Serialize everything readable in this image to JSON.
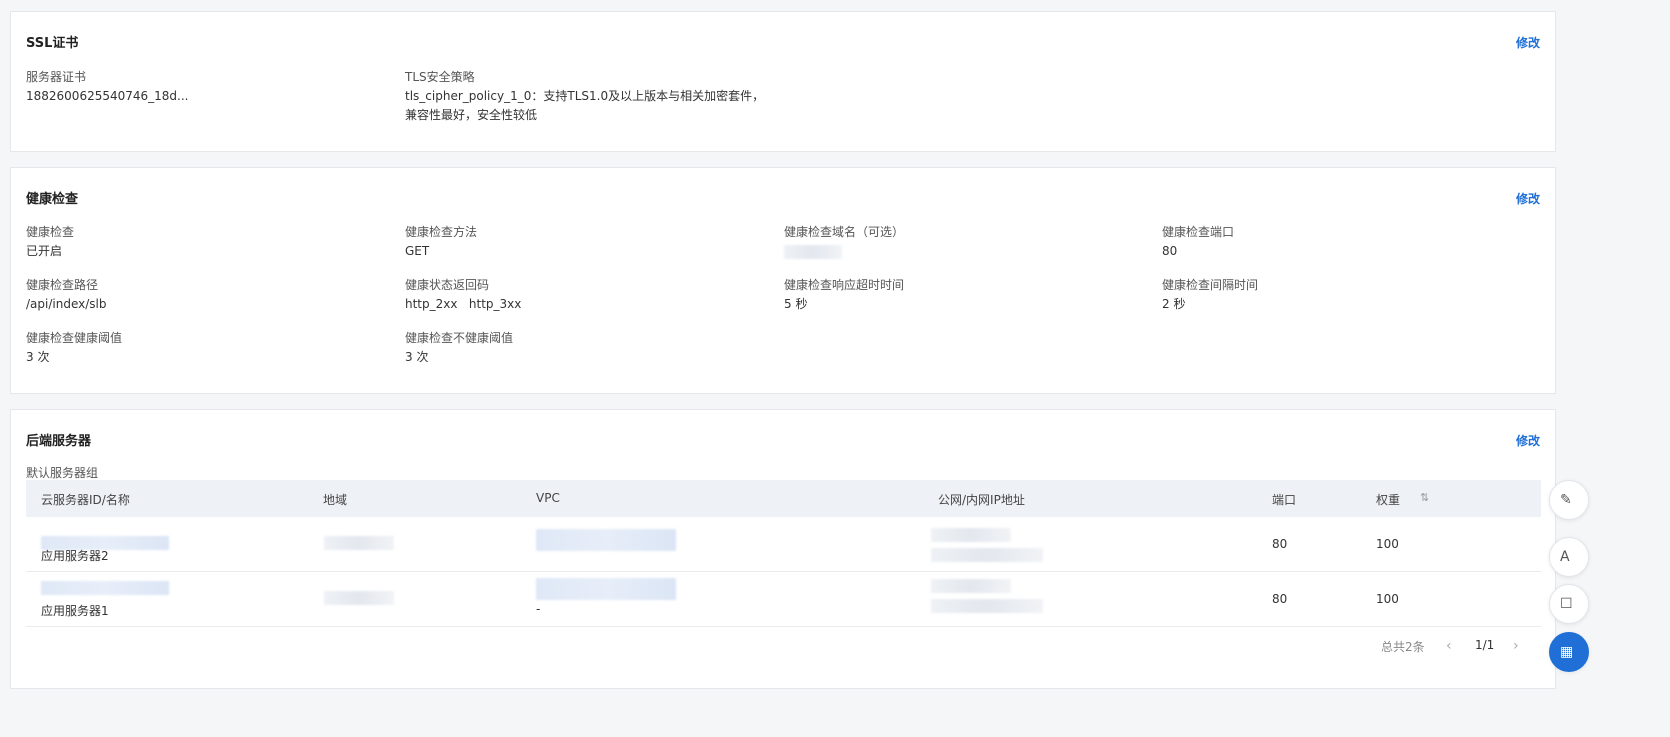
{
  "ssl": {
    "title": "SSL证书",
    "edit": "修改",
    "server_cert_label": "服务器证书",
    "server_cert_value": "1882600625540746_18d...",
    "tls_label": "TLS安全策略",
    "tls_value": "tls_cipher_policy_1_0：支持TLS1.0及以上版本与相关加密套件，兼容性最好，安全性较低"
  },
  "health": {
    "title": "健康检查",
    "edit": "修改",
    "fields": [
      {
        "label": "健康检查",
        "value": "已开启"
      },
      {
        "label": "健康检查方法",
        "value": "GET"
      },
      {
        "label": "健康检查域名（可选）",
        "value": ""
      },
      {
        "label": "健康检查端口",
        "value": "80"
      },
      {
        "label": "健康检查路径",
        "value": "/api/index/slb"
      },
      {
        "label": "健康状态返回码",
        "value": "http_2xx   http_3xx"
      },
      {
        "label": "健康检查响应超时时间",
        "value": "5 秒"
      },
      {
        "label": "健康检查间隔时间",
        "value": "2 秒"
      },
      {
        "label": "健康检查健康阈值",
        "value": "3 次"
      },
      {
        "label": "健康检查不健康阈值",
        "value": "3 次"
      }
    ]
  },
  "backend": {
    "title": "后端服务器",
    "edit": "修改",
    "group_label": "默认服务器组",
    "columns": [
      "云服务器ID/名称",
      "地域",
      "VPC",
      "公网/内网IP地址",
      "端口",
      "权重"
    ],
    "sort_icon": "sort-icon",
    "rows": [
      {
        "name": "应用服务器2",
        "port": "80",
        "weight": "100",
        "vpc_extra": ""
      },
      {
        "name": "应用服务器1",
        "port": "80",
        "weight": "100",
        "vpc_extra": "-"
      }
    ],
    "pager": {
      "total": "总共2条",
      "page": "1/1",
      "prev_icon": "chevron-left-icon",
      "next_icon": "chevron-right-icon"
    }
  },
  "float_buttons": [
    "edit-icon",
    "font-icon",
    "feedback-icon",
    "apps-icon"
  ],
  "colors": {
    "accent": "#1f6fd6",
    "header_bg": "#eef1f6"
  }
}
